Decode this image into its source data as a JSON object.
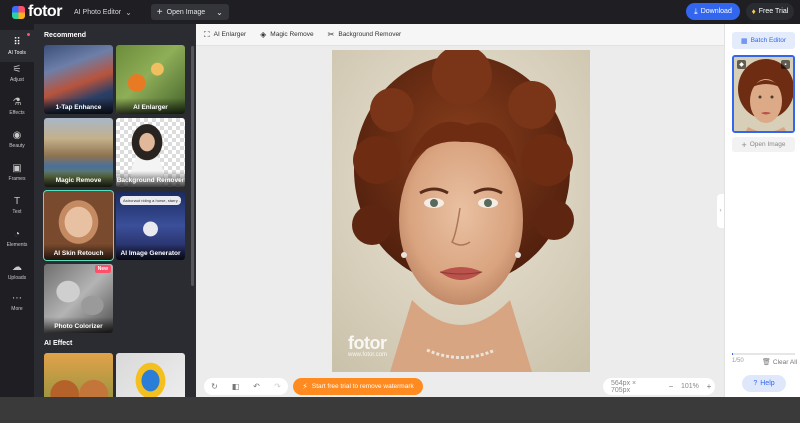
{
  "topbar": {
    "logo_text": "fotor",
    "editor_menu": "AI Photo Editor",
    "open_image": "Open Image",
    "download": "Download",
    "free_trial": "Free Trial"
  },
  "rail": [
    {
      "label": "AI Tools",
      "icon": "grid-icon"
    },
    {
      "label": "Adjust",
      "icon": "sliders-icon"
    },
    {
      "label": "Effects",
      "icon": "flask-icon"
    },
    {
      "label": "Beauty",
      "icon": "eye-icon"
    },
    {
      "label": "Frames",
      "icon": "frame-icon"
    },
    {
      "label": "Text",
      "icon": "text-icon"
    },
    {
      "label": "Elements",
      "icon": "shapes-icon"
    },
    {
      "label": "Uploads",
      "icon": "upload-icon"
    },
    {
      "label": "More",
      "icon": "more-icon"
    }
  ],
  "panel": {
    "recommend_title": "Recommend",
    "cards": [
      {
        "label": "1-Tap Enhance"
      },
      {
        "label": "AI Enlarger"
      },
      {
        "label": "Magic Remove"
      },
      {
        "label": "Background Remover"
      },
      {
        "label": "AI Skin Retouch"
      },
      {
        "label": "AI Image Generator"
      },
      {
        "label": "Photo Colorizer",
        "badge": "New"
      }
    ],
    "ai_effect_title": "AI Effect",
    "prompt_card_text": "Astronaut riding a horse, starry ..."
  },
  "canvas_tools": [
    {
      "label": "AI Enlarger",
      "icon": "enlarge-icon"
    },
    {
      "label": "Magic Remove",
      "icon": "eraser-icon"
    },
    {
      "label": "Background Remover",
      "icon": "scissors-icon"
    }
  ],
  "canvas": {
    "watermark_logo": "fotor",
    "watermark_url": "www.fotor.com"
  },
  "bottombar": {
    "watermark_cta": "Start free trial to remove watermark",
    "dimensions": "564px × 705px",
    "zoom": "101%"
  },
  "rpanel": {
    "batch_editor": "Batch Editor",
    "open_image": "Open Image",
    "count": "1/50",
    "progress_fraction": 0.02,
    "clear_all": "Clear All",
    "help": "Help"
  },
  "colors": {
    "accent": "#3366ee",
    "watermark_cta": "#ff8a1f",
    "new_badge": "#ff4f6a",
    "selected_outline": "#4fe3c1"
  }
}
